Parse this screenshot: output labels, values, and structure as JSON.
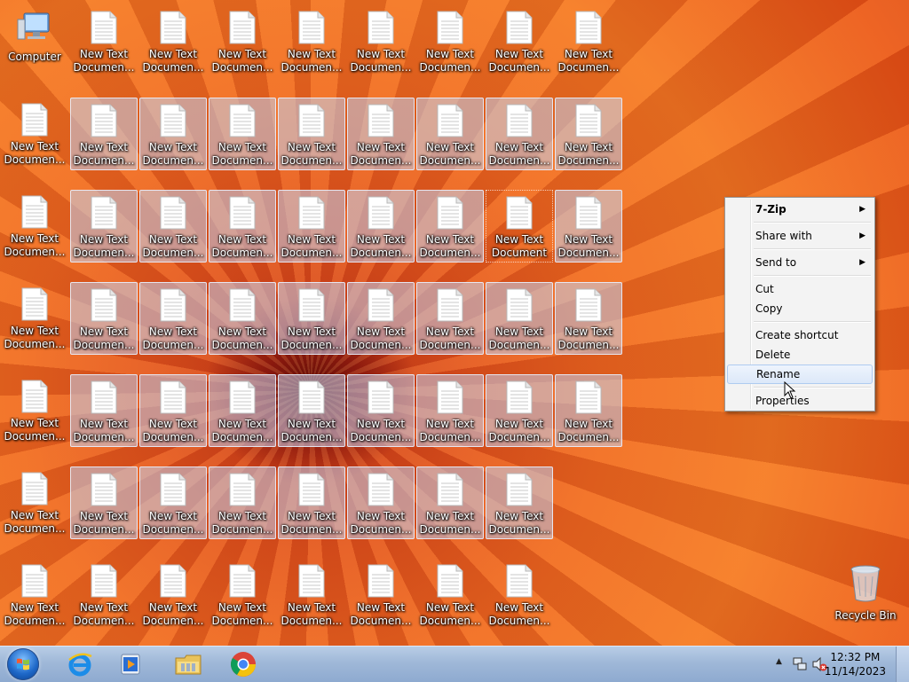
{
  "desktop": {
    "computer_label": "Computer",
    "recycle_bin_label": "Recycle Bin",
    "file_label_line1": "New Text",
    "file_label_line2_truncated": "Documen...",
    "file_label_line2_full": "Document"
  },
  "context_menu": {
    "items": [
      {
        "label": "7-Zip",
        "submenu": true,
        "bold": true
      },
      {
        "label": "Share with",
        "submenu": true
      },
      {
        "label": "Send to",
        "submenu": true
      },
      {
        "label": "Cut"
      },
      {
        "label": "Copy"
      },
      {
        "label": "Create shortcut"
      },
      {
        "label": "Delete"
      },
      {
        "label": "Rename",
        "highlighted": true
      },
      {
        "label": "Properties"
      }
    ],
    "arrow_glyph": "▶"
  },
  "taskbar": {
    "pinned": [
      "internet-explorer-icon",
      "media-player-icon",
      "file-explorer-icon",
      "chrome-icon"
    ],
    "clock_time": "12:32 PM",
    "clock_date": "11/14/2023"
  },
  "colors": {
    "selection": "#c3d2f0",
    "menu_highlight": "#dce8f9",
    "taskbar": "#9fb8d8"
  }
}
